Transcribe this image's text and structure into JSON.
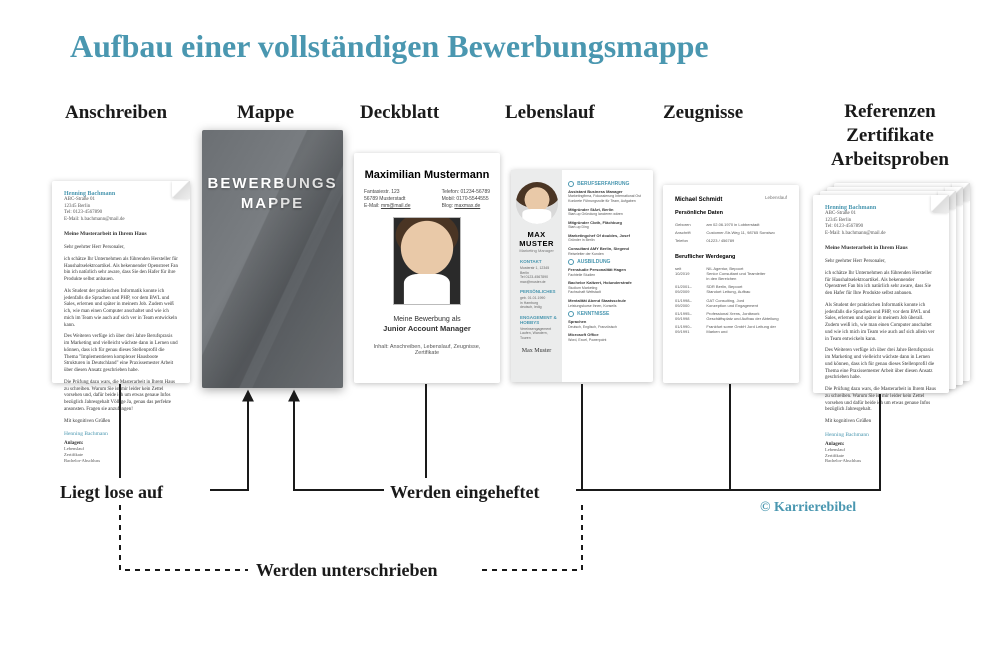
{
  "title": "Aufbau einer vollständigen Bewerbungsmappe",
  "columns": {
    "anschreiben": "Anschreiben",
    "mappe": "Mappe",
    "deckblatt": "Deckblatt",
    "lebenslauf": "Lebenslauf",
    "zeugnisse": "Zeugnisse",
    "referenzen_l1": "Referenzen",
    "referenzen_l2": "Zertifikate",
    "referenzen_l3": "Arbeitsproben"
  },
  "mappe_label": "BEWERBUNGS\nMAPPE",
  "deckblatt": {
    "name": "Maximilian Mustermann",
    "contact_left": "Fantasiestr. 123\n56789 Musterstadt\nE-Mail: mm@mail.de",
    "contact_right": "Telefon: 01234-56789\nMobil: 0170-5544555\nBlog: maxmax.de",
    "role_intro": "Meine Bewerbung als",
    "role": "Junior Account Manager",
    "inhalt": "Inhalt: Anschreiben, Lebenslauf, Zeugnisse, Zertifikate"
  },
  "lebenslauf": {
    "name": "MAX MUSTER",
    "subtitle": "Marketing Manager",
    "side_sections": [
      "KONTAKT",
      "PERSÖNLICHES",
      "ENGAGEMENT & HOBBYS"
    ],
    "signature": "Max Muster",
    "main_sections": [
      "BERUFSERFAHRUNG",
      "AUSBILDUNG",
      "KENNTNISSE"
    ]
  },
  "zeugnis": {
    "name": "Michael Schmidt",
    "date_label": "Lebenslauf",
    "section1": "Persönliche Daten",
    "section2": "Beruflicher Werdegang"
  },
  "letter": {
    "sender": "Henning Bachmann",
    "subject": "Meine Musterarbeit in Ihrem Haus",
    "greeting": "Sehr geehrter Herr Personaler,",
    "closing": "Mit kognitiven Grüßen",
    "signature": "Henning Bachmann",
    "attachments_label": "Anlagen:",
    "attachments": "Lebenslauf\nZertifikate\nBachelor-Abschluss"
  },
  "annotations": {
    "liegt_lose": "Liegt lose auf",
    "eingeheftet": "Werden eingeheftet",
    "unterschrieben": "Werden unterschrieben"
  },
  "credit": "© Karrierebibel"
}
